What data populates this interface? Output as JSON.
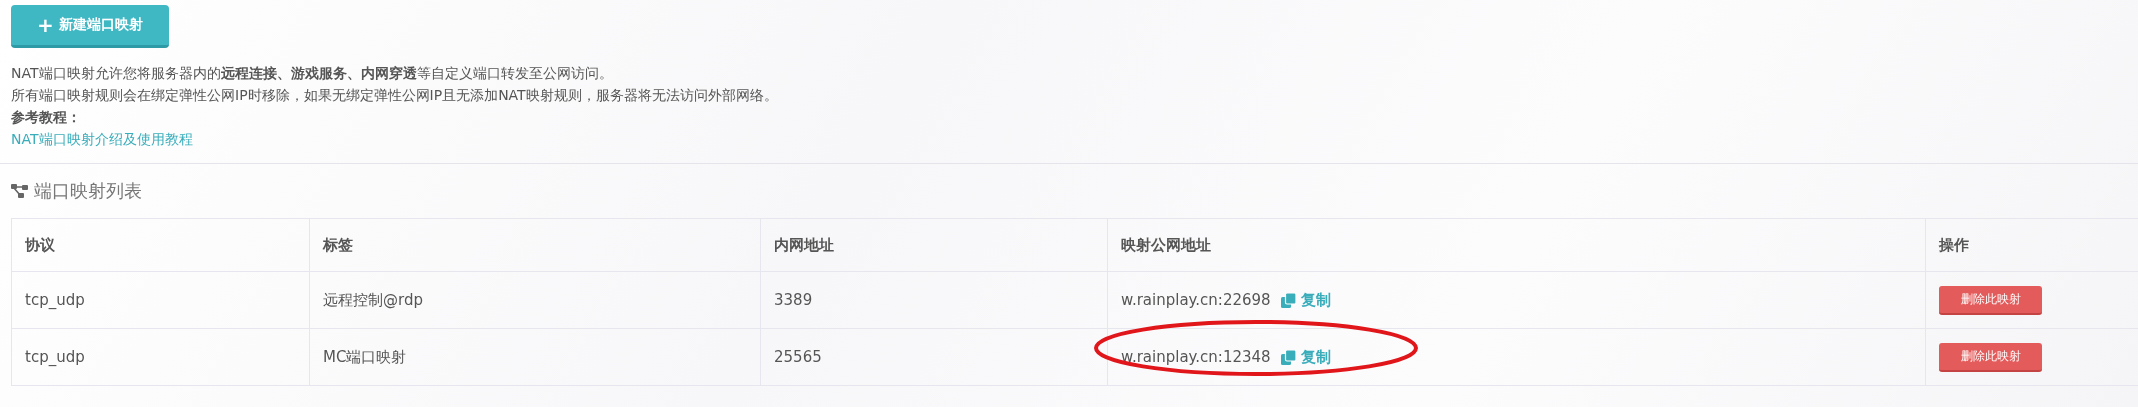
{
  "new_button": {
    "icon": "+",
    "label": "新建端口映射"
  },
  "description": {
    "lines": [
      "NAT端口映射允许您将服务器内的**远程连接、游戏服务、内网穿透**等自定义端口转发至公网访问。",
      "所有端口映射规则会在绑定弹性公网IP时移除，如果无绑定弹性公网IP且无添加NAT映射规则，服务器将无法访问外部网络。"
    ],
    "reference_label": "参考教程：",
    "reference_link": "NAT端口映射介绍及使用教程"
  },
  "section_title": "端口映射列表",
  "table": {
    "columns": [
      "协议",
      "标签",
      "内网地址",
      "映射公网地址",
      "操作"
    ],
    "rows": [
      {
        "protocol": "tcp_udp",
        "label": "远程控制@rdp",
        "internal": "3389",
        "public": "w.rainplay.cn:22698",
        "copy": "复制",
        "action": "删除此映射",
        "highlighted": false
      },
      {
        "protocol": "tcp_udp",
        "label": "MC端口映射",
        "internal": "25565",
        "public": "w.rainplay.cn:12348",
        "copy": "复制",
        "action": "删除此映射",
        "highlighted": true
      }
    ]
  }
}
